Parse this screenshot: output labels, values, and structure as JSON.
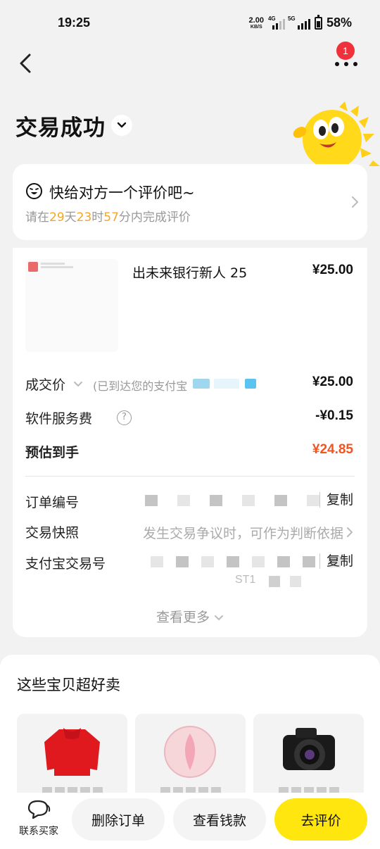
{
  "status_bar": {
    "time": "19:25",
    "speed_value": "2.00",
    "speed_unit": "KB/S",
    "net1": "4G",
    "net2": "5G",
    "battery": "58%"
  },
  "nav": {
    "badge_count": "1"
  },
  "header": {
    "title": "交易成功"
  },
  "review": {
    "title": "快给对方一个评价吧~",
    "prefix": "请在",
    "days": "29",
    "days_unit": "天",
    "hours": "23",
    "hours_unit": "时",
    "minutes": "57",
    "suffix": "分内完成评价"
  },
  "order": {
    "product_name": "出未来银行新人 25",
    "product_price": "¥25.00",
    "deal_price_label": "成交价",
    "deal_price_note": "(已到达您的支付宝",
    "deal_price_value": "¥25.00",
    "service_fee_label": "软件服务费",
    "service_fee_value": "-¥0.15",
    "estimated_label": "预估到手",
    "estimated_value": "¥24.85",
    "order_no_label": "订单编号",
    "copy_label": "复制",
    "snapshot_label": "交易快照",
    "snapshot_note": "发生交易争议时，可作为判断依据",
    "alipay_no_label": "支付宝交易号",
    "alipay_trail": "ST1",
    "see_more": "查看更多"
  },
  "recommend": {
    "title": "这些宝贝超好卖"
  },
  "bottom": {
    "contact_label": "联系买家",
    "delete_label": "删除订单",
    "view_money_label": "查看钱款",
    "review_label": "去评价"
  },
  "colors": {
    "accent_yellow": "#ffe60f",
    "countdown_orange": "#f5a623",
    "amount_orange": "#f05522",
    "badge_red": "#f0303a"
  }
}
